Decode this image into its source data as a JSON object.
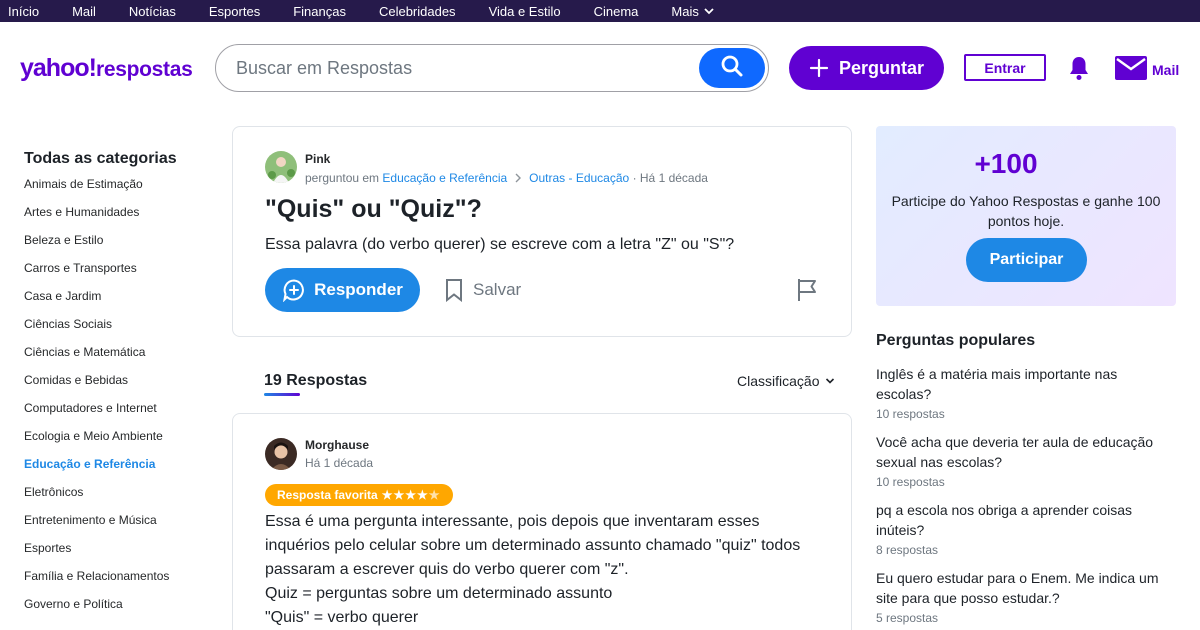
{
  "topnav": {
    "items": [
      "Início",
      "Mail",
      "Notícias",
      "Esportes",
      "Finanças",
      "Celebridades",
      "Vida e Estilo",
      "Cinema",
      "Mais"
    ]
  },
  "header": {
    "logo_main": "yahoo!",
    "logo_sub": "respostas",
    "search_placeholder": "Buscar em Respostas",
    "ask_label": "Perguntar",
    "login_label": "Entrar",
    "mail_label": "Mail"
  },
  "sidebar": {
    "title": "Todas as categorias",
    "items": [
      "Animais de Estimação",
      "Artes e Humanidades",
      "Beleza e Estilo",
      "Carros e Transportes",
      "Casa e Jardim",
      "Ciências Sociais",
      "Ciências e Matemática",
      "Comidas e Bebidas",
      "Computadores e Internet",
      "Ecologia e Meio Ambiente",
      "Educação e Referência",
      "Eletrônicos",
      "Entretenimento e Música",
      "Esportes",
      "Família e Relacionamentos",
      "Governo e Política"
    ],
    "active_item": "Educação e Referência"
  },
  "question": {
    "author": "Pink",
    "asked_in": "perguntou em",
    "category": "Educação e Referência",
    "subcategory": "Outras - Educação",
    "time": "· Há 1 década",
    "title": "\"Quis\" ou \"Quiz\"?",
    "body": "Essa palavra (do verbo querer) se escreve com a letra \"Z\" ou \"S\"?",
    "answer_label": "Responder",
    "save_label": "Salvar"
  },
  "answers": {
    "count_label": "19 Respostas",
    "sort_label": "Classificação"
  },
  "answer": {
    "author": "Morghause",
    "time": "Há 1 década",
    "badge_label": "Resposta favorita",
    "rating": 4,
    "rating_max": 5,
    "lines": [
      "Essa é uma pergunta interessante, pois depois que inventaram esses",
      "inquérios pelo celular sobre um determinado assunto chamado \"quiz\" todos",
      "passaram a escrever quis do verbo querer com \"z\".",
      "Quiz = perguntas sobre um determinado assunto",
      "\"Quis\" = verbo querer"
    ]
  },
  "promo": {
    "points": "+100",
    "text": "Participe do Yahoo Respostas e ganhe 100 pontos hoje.",
    "join_label": "Participar"
  },
  "popular": {
    "title": "Perguntas populares",
    "items": [
      {
        "question": "Inglês é a matéria mais importante nas escolas?",
        "count": "10 respostas"
      },
      {
        "question": "Você acha que deveria ter aula de educação sexual nas escolas?",
        "count": "10 respostas"
      },
      {
        "question": "pq a escola nos obriga a aprender coisas inúteis?",
        "count": "8 respostas"
      },
      {
        "question": "Eu quero estudar para o Enem. Me indica um site para que posso estudar.?",
        "count": "5 respostas"
      }
    ]
  },
  "colors": {
    "brand_purple": "#6001d2",
    "topnav_bg": "#261a4b",
    "link_blue": "#1e88e5",
    "badge_orange": "#ffa700"
  }
}
